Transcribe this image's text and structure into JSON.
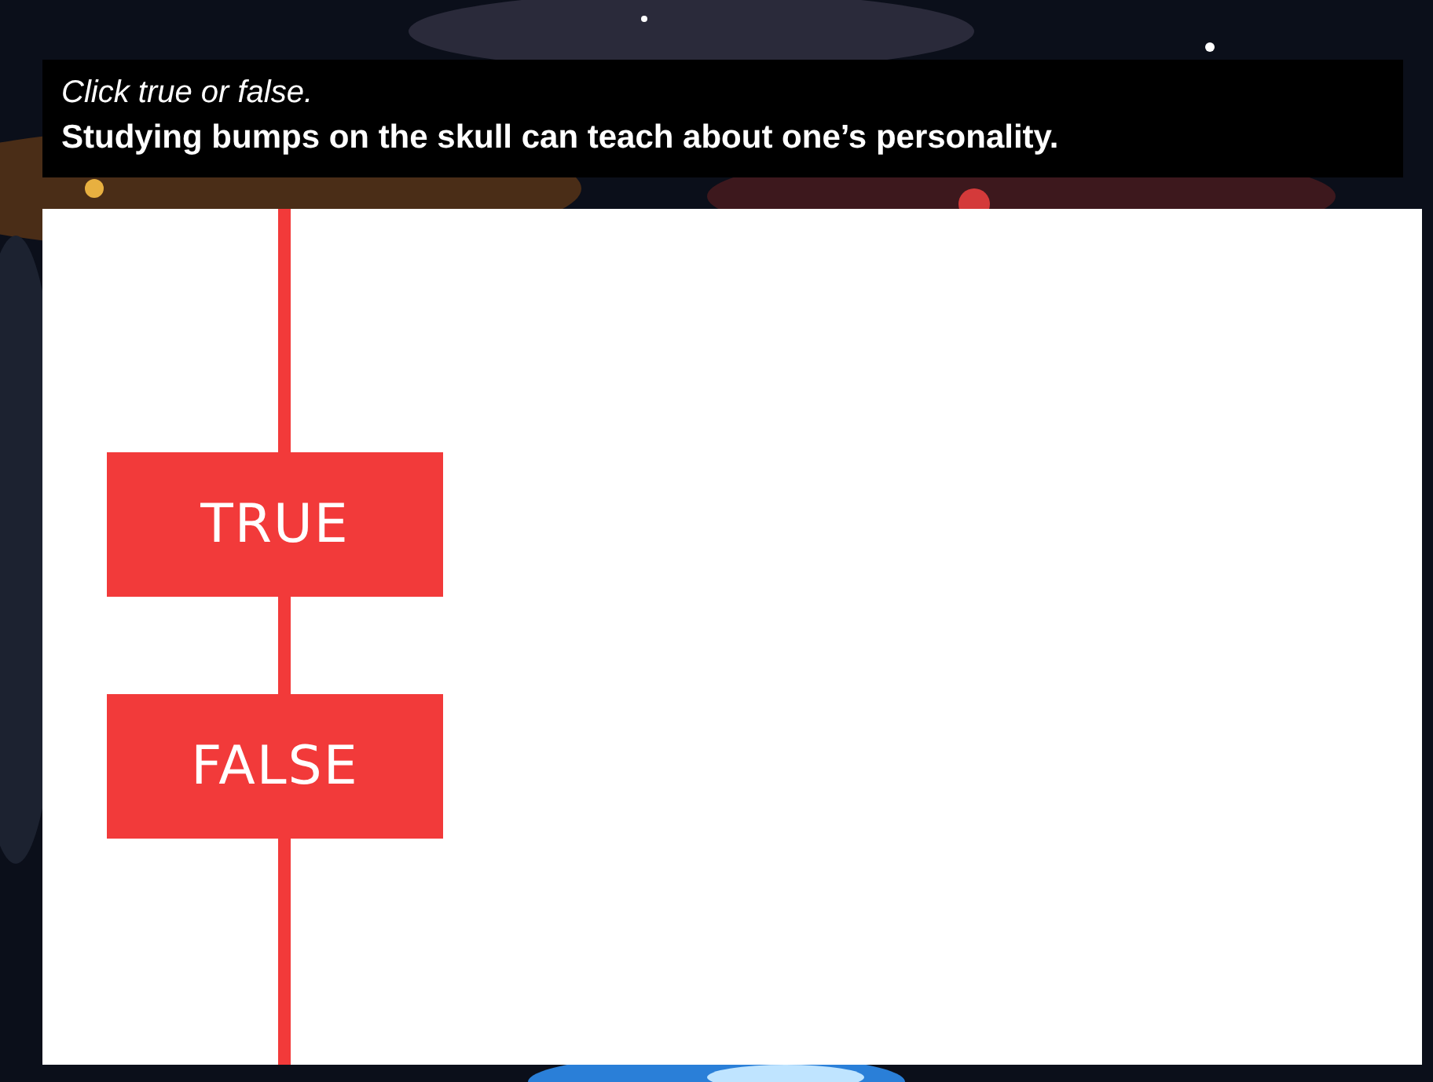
{
  "prompt": {
    "instruction": "Click true or false.",
    "question": "Studying bumps on the skull can teach about one’s personality."
  },
  "answers": [
    {
      "label": "TRUE"
    },
    {
      "label": "FALSE"
    }
  ]
}
